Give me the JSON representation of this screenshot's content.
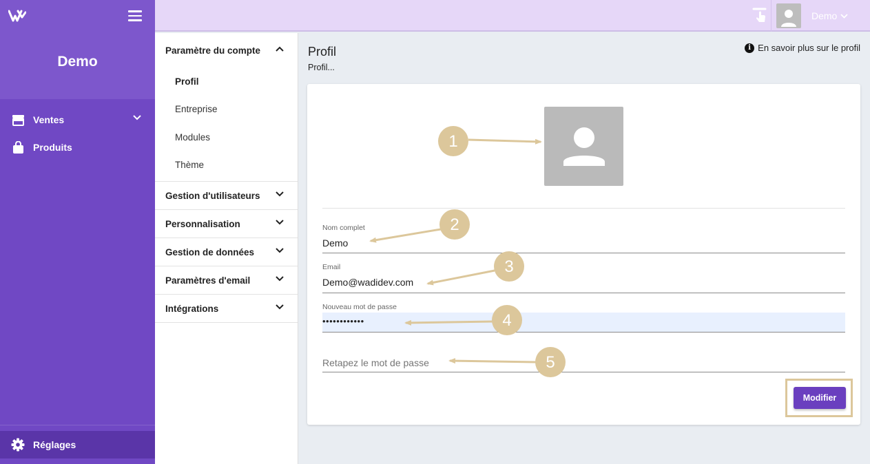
{
  "sidebar": {
    "brand": "Demo",
    "items": [
      {
        "label": "Ventes",
        "icon": "store-icon"
      },
      {
        "label": "Produits",
        "icon": "shopping-bag-icon"
      }
    ],
    "settings_label": "Réglages"
  },
  "topbar": {
    "user_name": "Demo"
  },
  "submenu": {
    "account": {
      "label": "Paramètre du compte",
      "items": [
        "Profil",
        "Entreprise",
        "Modules",
        "Thème"
      ],
      "active": "Profil"
    },
    "groups": [
      "Gestion d'utilisateurs",
      "Personnalisation",
      "Gestion de données",
      "Paramètres d'email",
      "Intégrations"
    ]
  },
  "page": {
    "title": "Profil",
    "subtitle": "Profil...",
    "learn_more": "En savoir plus sur le profil",
    "info_glyph": "i"
  },
  "form": {
    "name_label": "Nom complet",
    "name_value": "Demo",
    "email_label": "Email",
    "email_value": "Demo@wadidev.com",
    "password_label": "Nouveau mot de passe",
    "password_value": "••••••••••••",
    "confirm_placeholder": "Retapez le mot de passe",
    "submit_label": "Modifier"
  },
  "annotations": [
    "1",
    "2",
    "3",
    "4",
    "5"
  ],
  "colors": {
    "sidebar": "#7048c4",
    "sidebar_header": "#7d57cc",
    "topbar": "#e6d7f8",
    "accent_button": "#6a3fbf",
    "annotation": "#dcc79b"
  }
}
